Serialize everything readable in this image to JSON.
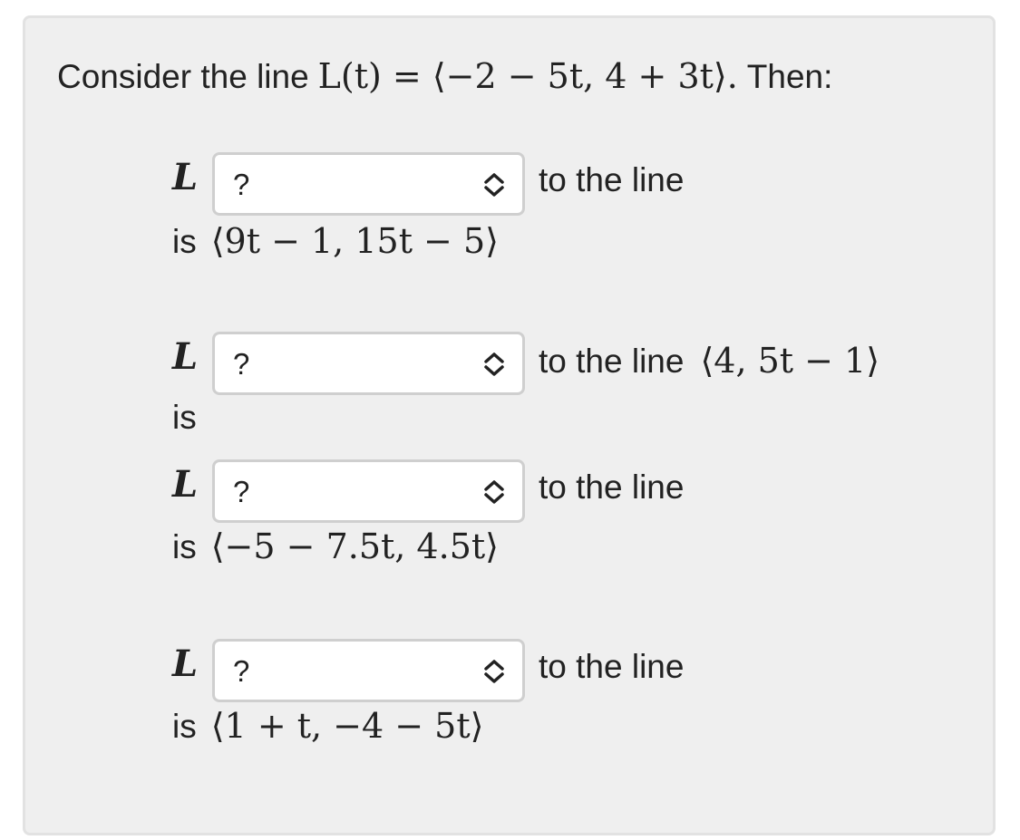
{
  "intro": {
    "text": "Consider the line",
    "equation": "L(t) = ⟨−2 − 5t, 4 + 3t⟩.",
    "suffix": "Then:"
  },
  "items": [
    {
      "var": "L",
      "selected": "?",
      "tail_text": "to the line",
      "tail_math": "",
      "is_text": "is",
      "is_math": "⟨9t − 1, 15t − 5⟩"
    },
    {
      "var": "L",
      "selected": "?",
      "tail_text": "to the line",
      "tail_math": "⟨4, 5t − 1⟩",
      "is_text": "is",
      "is_math": ""
    },
    {
      "var": "L",
      "selected": "?",
      "tail_text": "to the line",
      "tail_math": "",
      "is_text": "is",
      "is_math": "⟨−5 − 7.5t, 4.5t⟩"
    },
    {
      "var": "L",
      "selected": "?",
      "tail_text": "to the line",
      "tail_math": "",
      "is_text": "is",
      "is_math": "⟨1 + t, −4 − 5t⟩"
    }
  ],
  "icons": {
    "select": "chevron-up-down-icon"
  },
  "colors": {
    "panel_background": "#efefef",
    "panel_border": "#e2e2e2",
    "select_border": "#cfcfcf",
    "text": "#222222"
  }
}
